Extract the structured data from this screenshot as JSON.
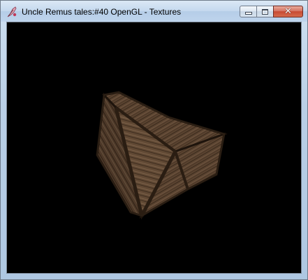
{
  "window": {
    "title": "Uncle Remus tales:#40 OpenGL - Textures",
    "icon": "feather-quill-icon"
  },
  "caption_buttons": {
    "minimize": "minimize-icon",
    "maximize": "maximize-icon",
    "close": "close-icon"
  },
  "colors": {
    "viewport_background": "#000000",
    "wood_dark": "#2a1d12",
    "wood_mid": "#5a4330",
    "wood_light": "#7b6149",
    "close_red": "#c74a33"
  }
}
